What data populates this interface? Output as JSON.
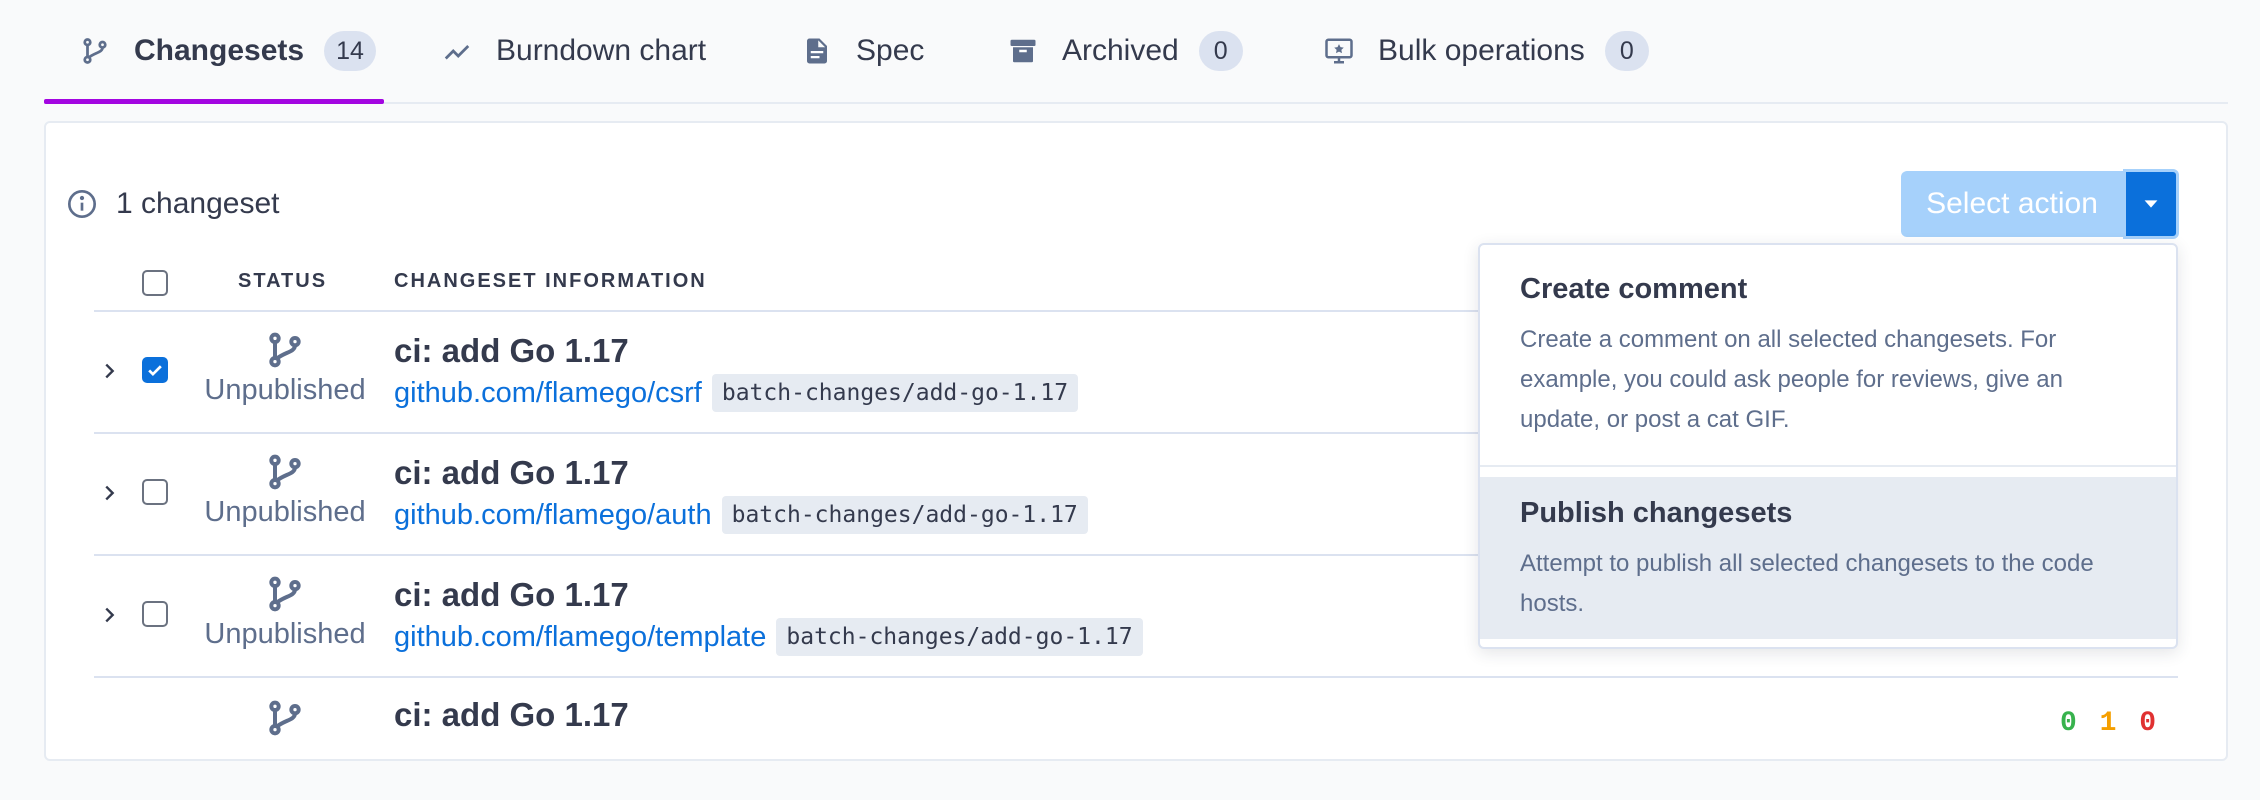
{
  "tabs": [
    {
      "label": "Changesets",
      "badge": "14",
      "icon": "branch-icon",
      "active": true
    },
    {
      "label": "Burndown chart",
      "icon": "chart-line-icon"
    },
    {
      "label": "Spec",
      "icon": "file-document-icon"
    },
    {
      "label": "Archived",
      "badge": "0",
      "icon": "archive-icon"
    },
    {
      "label": "Bulk operations",
      "badge": "0",
      "icon": "monitor-star-icon"
    }
  ],
  "summary": {
    "text": "1 changeset"
  },
  "toolbar": {
    "select_action_label": "Select action"
  },
  "table": {
    "headers": {
      "status": "STATUS",
      "info": "CHANGESET INFORMATION"
    },
    "rows": [
      {
        "status": "Unpublished",
        "title": "ci: add Go 1.17",
        "repo": "github.com/flamego/csrf",
        "branch": "batch-changes/add-go-1.17",
        "checked": true
      },
      {
        "status": "Unpublished",
        "title": "ci: add Go 1.17",
        "repo": "github.com/flamego/auth",
        "branch": "batch-changes/add-go-1.17",
        "checked": false
      },
      {
        "status": "Unpublished",
        "title": "ci: add Go 1.17",
        "repo": "github.com/flamego/template",
        "branch": "batch-changes/add-go-1.17",
        "checked": false
      },
      {
        "title": "ci: add Go 1.17"
      }
    ]
  },
  "diffstat": {
    "added": "0",
    "changed": "1",
    "deleted": "0"
  },
  "dropdown": {
    "items": [
      {
        "title": "Create comment",
        "description": "Create a comment on all selected changesets. For example, you could ask people for reviews, give an update, or post a cat GIF."
      },
      {
        "title": "Publish changesets",
        "description": "Attempt to publish all selected changesets to the code hosts."
      }
    ]
  },
  "colors": {
    "accent": "#a305e1",
    "link": "#0b70db",
    "primary": "#0b70db",
    "primary_disabled": "#a6d1fb",
    "badge_bg": "#dbe2f0",
    "muted_text": "#5e6e8c",
    "diff_added": "#37b24d",
    "diff_changed": "#f59f00",
    "diff_deleted": "#e03131"
  }
}
